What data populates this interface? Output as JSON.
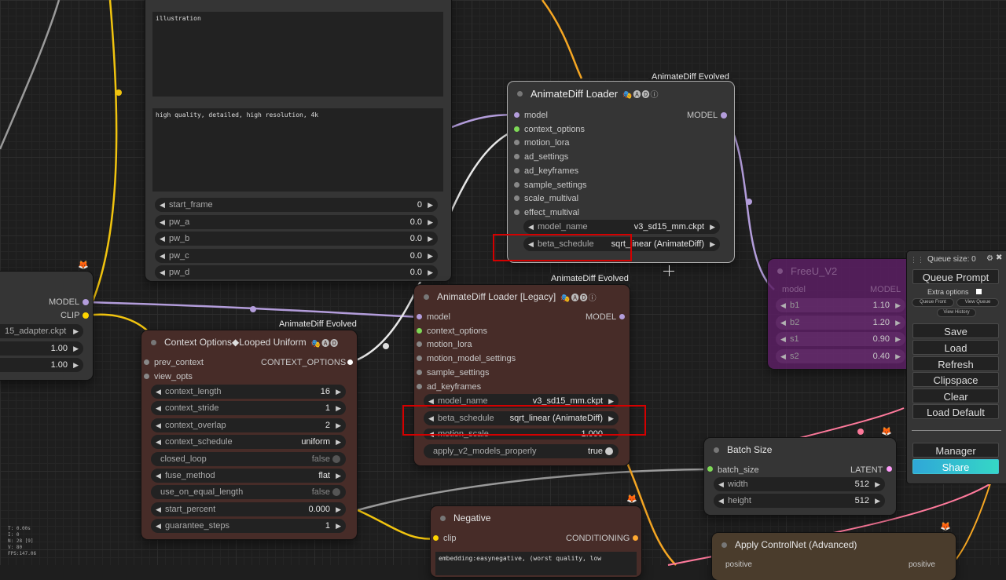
{
  "canvas_lines": {
    "illustration_text": "illustration",
    "quality_text": "high quality, detailed, high resolution, 4k"
  },
  "prompt_node": {
    "widgets": [
      {
        "label": "start_frame",
        "value": "0"
      },
      {
        "label": "pw_a",
        "value": "0.0"
      },
      {
        "label": "pw_b",
        "value": "0.0"
      },
      {
        "label": "pw_c",
        "value": "0.0"
      },
      {
        "label": "pw_d",
        "value": "0.0"
      }
    ]
  },
  "left_node": {
    "model_out": "MODEL",
    "clip_out": "CLIP",
    "ckpt_value": "15_adapter.ckpt",
    "val1": "1.00",
    "val2": "1.00"
  },
  "loader": {
    "pack_tag": "AnimateDiff Evolved",
    "title": "AnimateDiff Loader",
    "icons": "🎭🅐🅓ⓘ",
    "inputs": [
      "model",
      "context_options",
      "motion_lora",
      "ad_settings",
      "ad_keyframes",
      "sample_settings",
      "scale_multival",
      "effect_multival"
    ],
    "output": "MODEL",
    "model_name_label": "model_name",
    "model_name_value": "v3_sd15_mm.ckpt",
    "beta_label": "beta_schedule",
    "beta_value": "sqrt_linear (AnimateDiff)"
  },
  "legacy": {
    "pack_tag": "AnimateDiff Evolved",
    "title": "AnimateDiff Loader [Legacy]",
    "icons": "🎭🅐🅓ⓘ",
    "inputs": [
      "model",
      "context_options",
      "motion_lora",
      "motion_model_settings",
      "sample_settings",
      "ad_keyframes"
    ],
    "output": "MODEL",
    "model_name_label": "model_name",
    "model_name_value": "v3_sd15_mm.ckpt",
    "beta_label": "beta_schedule",
    "beta_value": "sqrt_linear (AnimateDiff)",
    "scale_label": "motion_scale",
    "scale_value": "1.000",
    "v2_label": "apply_v2_models_properly",
    "v2_value": "true"
  },
  "context": {
    "pack_tag": "AnimateDiff Evolved",
    "title": "Context Options◆Looped Uniform",
    "icons": "🎭🅐🅓",
    "inputs": [
      "prev_context",
      "view_opts"
    ],
    "output": "CONTEXT_OPTIONS",
    "widgets": [
      {
        "label": "context_length",
        "value": "16",
        "kind": "num"
      },
      {
        "label": "context_stride",
        "value": "1",
        "kind": "num"
      },
      {
        "label": "context_overlap",
        "value": "2",
        "kind": "num"
      },
      {
        "label": "context_schedule",
        "value": "uniform",
        "kind": "combo"
      },
      {
        "label": "closed_loop",
        "value": "false",
        "kind": "toggle"
      },
      {
        "label": "fuse_method",
        "value": "flat",
        "kind": "combo"
      },
      {
        "label": "use_on_equal_length",
        "value": "false",
        "kind": "toggle"
      },
      {
        "label": "start_percent",
        "value": "0.000",
        "kind": "num"
      },
      {
        "label": "guarantee_steps",
        "value": "1",
        "kind": "num"
      }
    ]
  },
  "freeu": {
    "title": "FreeU_V2",
    "input": "model",
    "output": "MODEL",
    "widgets": [
      {
        "label": "b1",
        "value": "1.10"
      },
      {
        "label": "b2",
        "value": "1.20"
      },
      {
        "label": "s1",
        "value": "0.90"
      },
      {
        "label": "s2",
        "value": "0.40"
      }
    ]
  },
  "batch": {
    "title": "Batch Size",
    "input": "batch_size",
    "output": "LATENT",
    "widgets": [
      {
        "label": "width",
        "value": "512"
      },
      {
        "label": "height",
        "value": "512"
      }
    ]
  },
  "negative": {
    "title": "Negative",
    "input": "clip",
    "output": "CONDITIONING",
    "text": "embedding:easynegative, (worst quality, low"
  },
  "controlnet": {
    "title": "Apply ControlNet (Advanced)",
    "in1": "positive",
    "out1": "positive"
  },
  "menu": {
    "queue_size": "Queue size: 0",
    "queue_prompt": "Queue Prompt",
    "extra_options": "Extra options",
    "queue_front": "Queue Front",
    "view_queue": "View Queue",
    "view_history": "View History",
    "save": "Save",
    "load": "Load",
    "refresh": "Refresh",
    "clipspace": "Clipspace",
    "clear": "Clear",
    "load_default": "Load Default",
    "manager": "Manager",
    "share": "Share"
  },
  "stats": {
    "t": "T: 0.00s",
    "i": "I: 0",
    "n": "N: 28 [9]",
    "v": "V: 80",
    "fps": "FPS:147.06"
  },
  "colors": {
    "model_link": "#b39ddb",
    "clip_link": "#ffd500",
    "context_link": "#ffffff",
    "latent_link": "#ff9cf9",
    "cond_link": "#ffa931",
    "highlight": "#d40000"
  }
}
